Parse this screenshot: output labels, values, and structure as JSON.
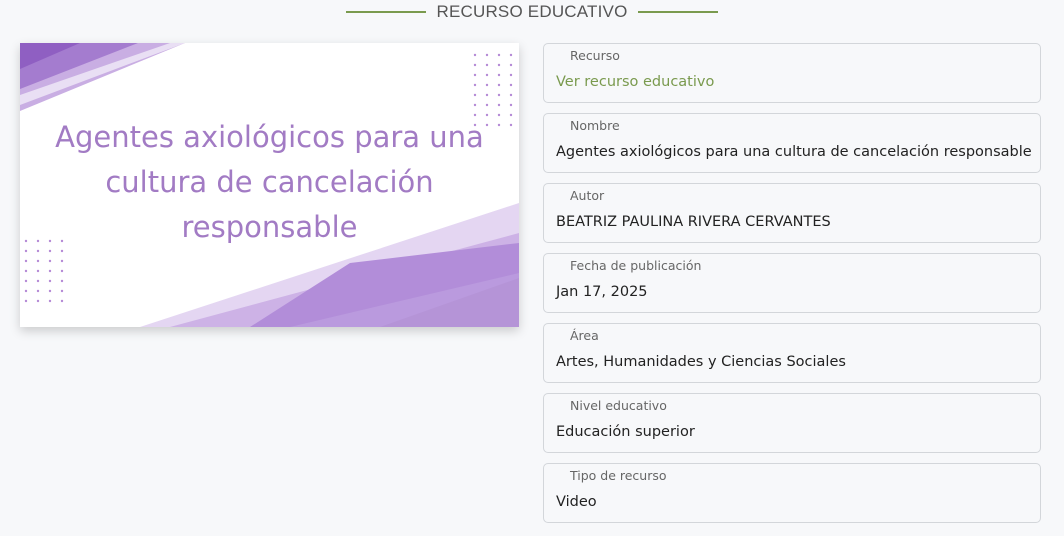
{
  "colors": {
    "accent": "#7a9a4e",
    "thumb_purple": "#a27bc4"
  },
  "section": {
    "title": "RECURSO EDUCATIVO"
  },
  "thumbnail": {
    "title_lines": [
      "Agentes axiológicos para una",
      "cultura de cancelación",
      "responsable"
    ]
  },
  "fields": {
    "recurso": {
      "label": "Recurso",
      "value": "Ver recurso educativo"
    },
    "nombre": {
      "label": "Nombre",
      "value": "Agentes axiológicos para una cultura de cancelación responsable"
    },
    "autor": {
      "label": "Autor",
      "value": "BEATRIZ PAULINA RIVERA CERVANTES"
    },
    "fecha": {
      "label": "Fecha de publicación",
      "value": "Jan 17, 2025"
    },
    "area": {
      "label": "Área",
      "value": "Artes, Humanidades y Ciencias Sociales"
    },
    "nivel": {
      "label": "Nivel educativo",
      "value": "Educación superior"
    },
    "tipo": {
      "label": "Tipo de recurso",
      "value": "Video"
    }
  }
}
